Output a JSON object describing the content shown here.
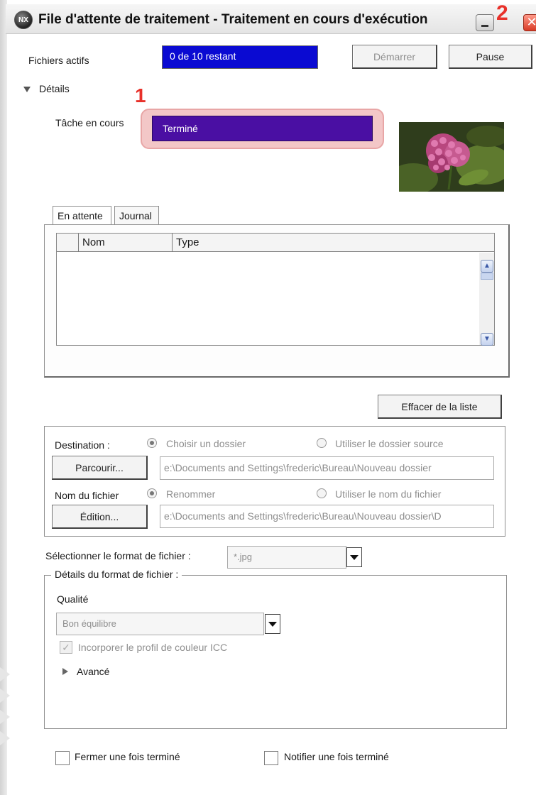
{
  "window": {
    "logo_text": "NX",
    "title": "File d'attente de traitement - Traitement en cours d'exécution",
    "close_glyph": "✕",
    "markers": {
      "task_marker": "1",
      "minimize_marker": "2"
    }
  },
  "active_files": {
    "label": "Fichiers actifs",
    "progress_text": "0 de 10 restant",
    "start_button": "Démarrer",
    "pause_button": "Pause"
  },
  "details": {
    "label": "Détails",
    "current_task_label": "Tâche en cours",
    "current_task_value": "Terminé"
  },
  "queue": {
    "tabs": [
      {
        "label": "En attente",
        "active": true
      },
      {
        "label": "Journal",
        "active": false
      }
    ],
    "columns": [
      "Nom",
      "Type"
    ],
    "clear_button": "Effacer de la liste"
  },
  "destination": {
    "label": "Destination :",
    "option_choose": "Choisir un dossier",
    "option_source": "Utiliser le dossier source",
    "browse_button": "Parcourir...",
    "path": "e:\\Documents and Settings\\frederic\\Bureau\\Nouveau dossier"
  },
  "filename": {
    "label": "Nom du fichier",
    "option_rename": "Renommer",
    "option_use_name": "Utiliser le nom du fichier",
    "edit_button": "Édition...",
    "path": "e:\\Documents and Settings\\frederic\\Bureau\\Nouveau dossier\\D"
  },
  "format": {
    "select_label": "Sélectionner le format de fichier :",
    "select_value": "*.jpg",
    "details_legend": "Détails du format de fichier :",
    "quality_label": "Qualité",
    "quality_value": "Bon équilibre",
    "icc_label": "Incorporer le profil de couleur ICC",
    "icc_checked": true,
    "advanced_label": "Avancé"
  },
  "footer": {
    "close_when_done": "Fermer une fois terminé",
    "notify_when_done": "Notifier une fois terminé"
  },
  "colors": {
    "progress_blue": "#0a0ad2",
    "task_purple": "#4a0fa3",
    "highlight_pink": "#f3c7c7",
    "marker_red": "#e8312a"
  }
}
